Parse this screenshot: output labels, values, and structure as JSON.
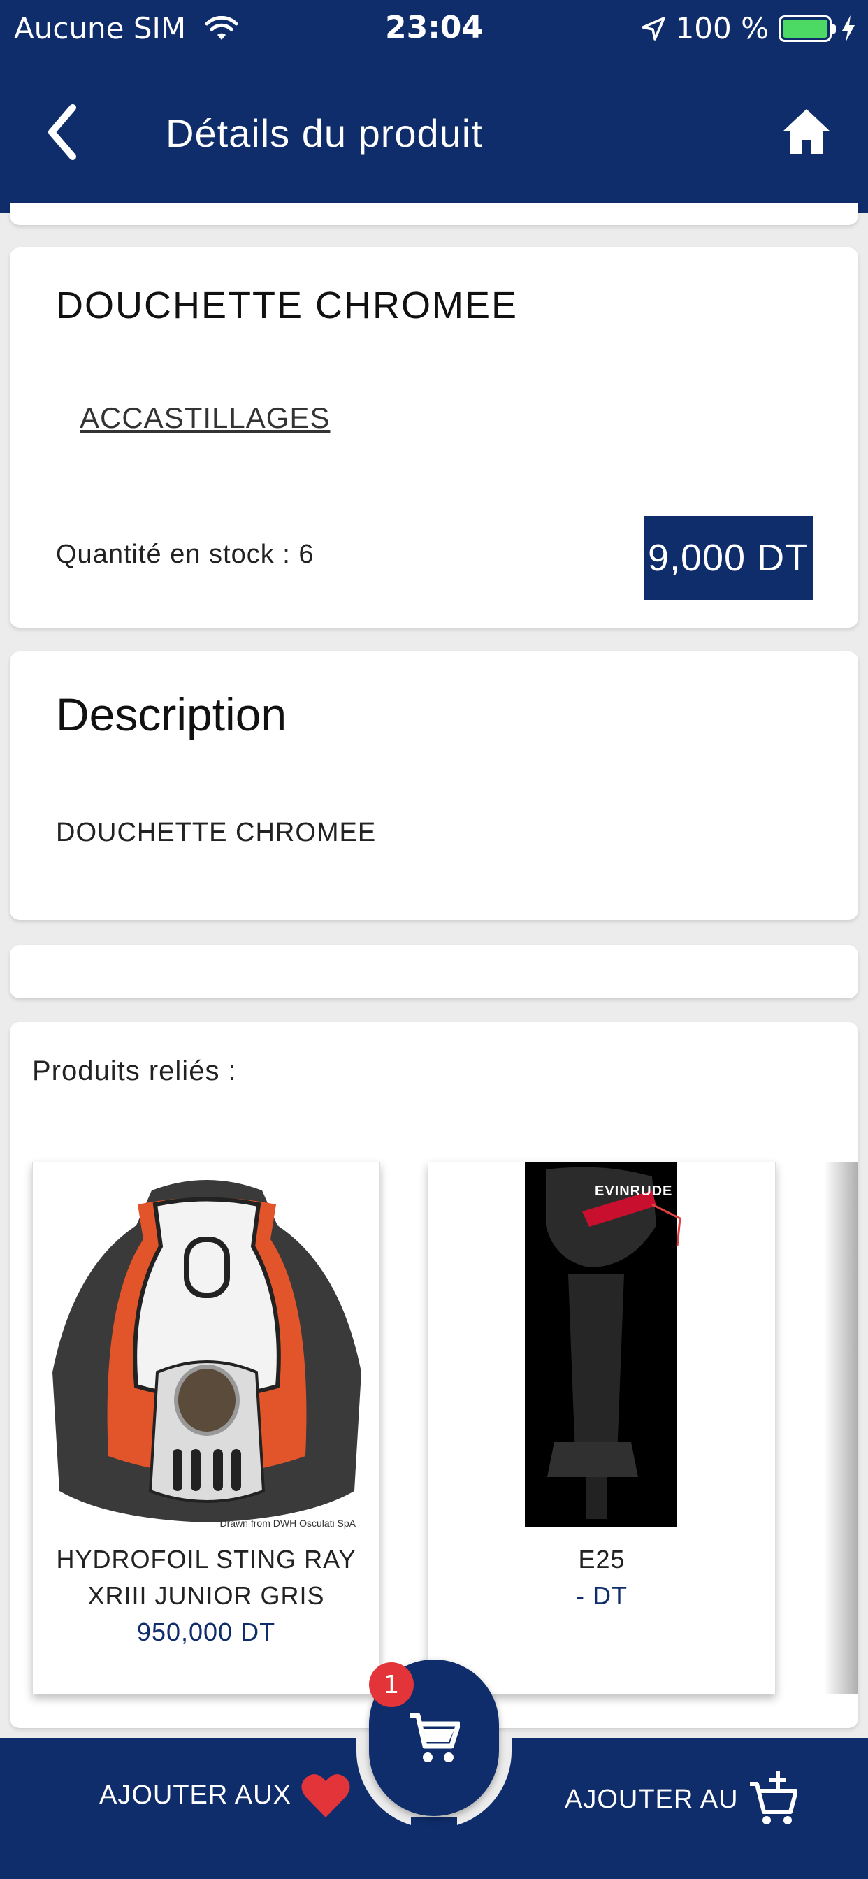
{
  "status_bar": {
    "carrier": "Aucune SIM",
    "time": "23:04",
    "battery_percent": "100 %",
    "battery_level": 1.0
  },
  "header": {
    "title": "Détails du produit",
    "back_icon": "chevron-left-icon",
    "home_icon": "home-icon"
  },
  "product": {
    "name": "DOUCHETTE CHROMEE",
    "category": "ACCASTILLAGES",
    "stock_text": "Quantité en stock : 6",
    "price": "9,000 DT"
  },
  "description": {
    "heading": "Description",
    "text": "DOUCHETTE CHROMEE"
  },
  "related": {
    "title": "Produits reliés :",
    "items": [
      {
        "name": "HYDROFOIL STING RAY XRIII JUNIOR GRIS",
        "price": "950,000 DT",
        "image_caption": "Drawn from DWH Osculati SpA"
      },
      {
        "name": "E25",
        "price": "- DT",
        "image_logo": "EVINRUDE"
      }
    ]
  },
  "bottom_bar": {
    "favorites_label": "AJOUTER AUX",
    "cart_label": "AJOUTER AU",
    "cart_count": "1"
  },
  "colors": {
    "primary": "#0f2d6b",
    "badge": "#e3343a",
    "heart": "#e3343a",
    "battery": "#4cd964"
  }
}
